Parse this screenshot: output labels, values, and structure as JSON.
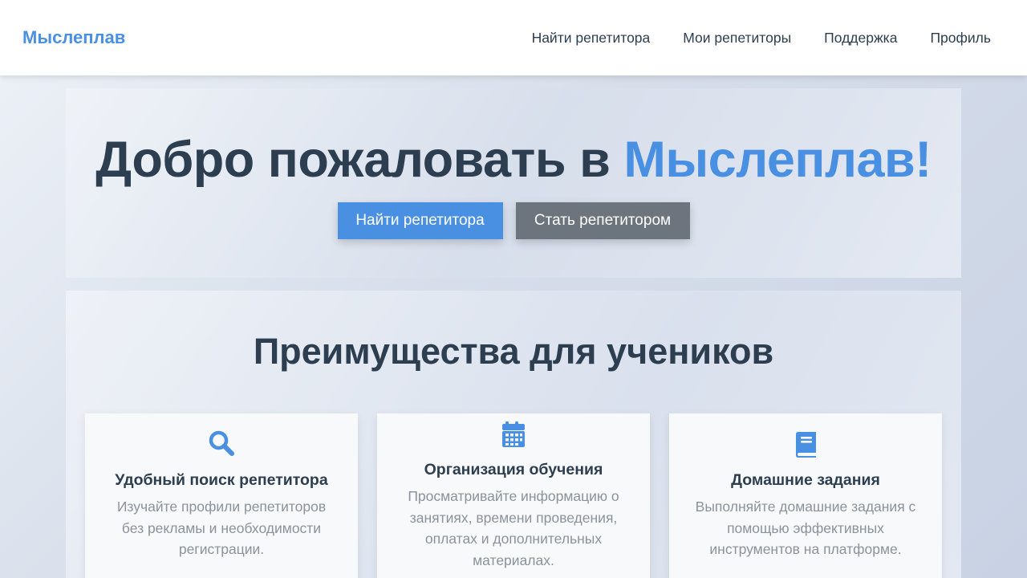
{
  "navbar": {
    "brand": "Мыслеплав",
    "links": [
      {
        "label": "Найти репетитора"
      },
      {
        "label": "Мои репетиторы"
      },
      {
        "label": "Поддержка"
      },
      {
        "label": "Профиль"
      }
    ]
  },
  "hero": {
    "title_prefix": "Добро пожаловать в ",
    "title_accent": "Мыслеплав!",
    "primary_button": "Найти репетитора",
    "secondary_button": "Стать репетитором"
  },
  "features": {
    "title": "Преимущества для учеников",
    "cards": [
      {
        "icon": "search-icon",
        "title": "Удобный поиск репетитора",
        "text": "Изучайте профили репетиторов без рекламы и необходимости регистрации."
      },
      {
        "icon": "calendar-icon",
        "title": "Организация обучения",
        "text": "Просматривайте информацию о занятиях, времени проведения, оплатах и дополнительных материалах."
      },
      {
        "icon": "book-icon",
        "title": "Домашние задания",
        "text": "Выполняйте домашние задания с помощью эффективных инструментов на платформе."
      }
    ]
  },
  "colors": {
    "accent": "#4a90e2",
    "secondary_button": "#6c757d",
    "heading_text": "#2c3e50",
    "muted_text": "#8a939c"
  }
}
